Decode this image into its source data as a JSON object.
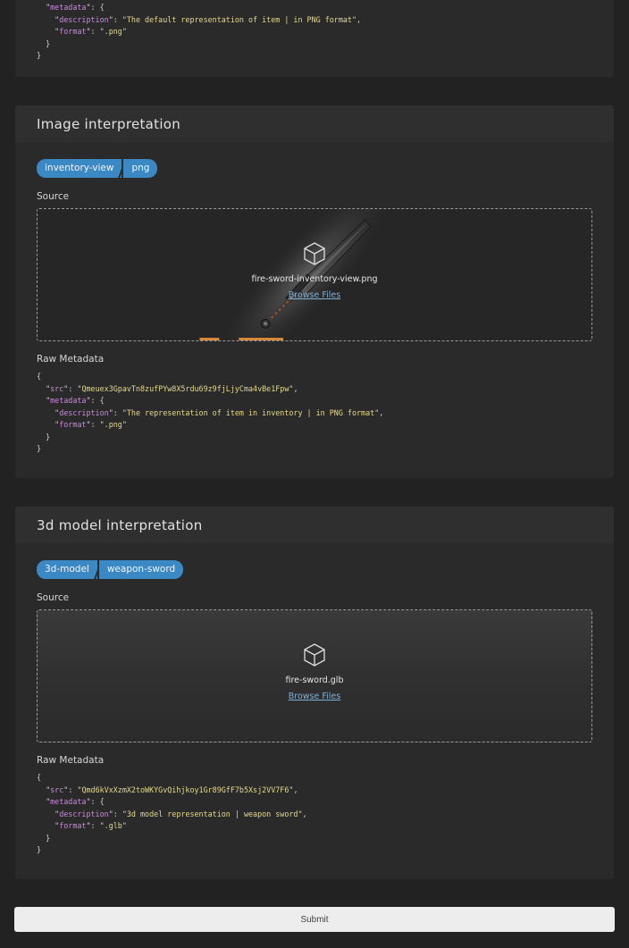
{
  "top_metadata": {
    "lines": [
      {
        "indent": "  ",
        "key": "metadata",
        "rest": ": {"
      },
      {
        "indent": "    ",
        "key": "description",
        "sep": ": ",
        "value": "The default representation of item | in PNG format",
        "tail": ","
      },
      {
        "indent": "    ",
        "key": "format",
        "sep": ": ",
        "value": ".png",
        "tail": ""
      },
      {
        "indent": "  ",
        "plain": "}"
      },
      {
        "indent": "",
        "plain": "}"
      }
    ]
  },
  "sections": [
    {
      "title": "Image interpretation",
      "tags": [
        "inventory-view",
        "png"
      ],
      "source_label": "Source",
      "filename": "fire-sword-inventory-view.png",
      "browse_label": "Browse Files",
      "raw_label": "Raw Metadata",
      "metadata": {
        "src": "Qmeuex3GpavTn8zufPYw8X5rdu69z9fjLjyCma4vBe1Fpw",
        "description": "The representation of item in inventory | in PNG format",
        "format": ".png"
      }
    },
    {
      "title": "3d model interpretation",
      "tags": [
        "3d-model",
        "weapon-sword"
      ],
      "source_label": "Source",
      "filename": "fire-sword.glb",
      "browse_label": "Browse Files",
      "raw_label": "Raw Metadata",
      "metadata": {
        "src": "Qmd6kVxXzmX2toWKYGvQihjkoy1Gr89GfF7b5Xsj2VV7F6",
        "description": "3d model representation | weapon sword",
        "format": ".glb"
      }
    }
  ],
  "submit_label": "Submit",
  "colors": {
    "background": "#222222",
    "card": "#2a2a2a",
    "tag": "#3a88c4",
    "link": "#7fb0d6",
    "json_key": "#c78bd8",
    "json_string": "#e6d98a"
  },
  "icons": {
    "upload": "cube-icon"
  }
}
